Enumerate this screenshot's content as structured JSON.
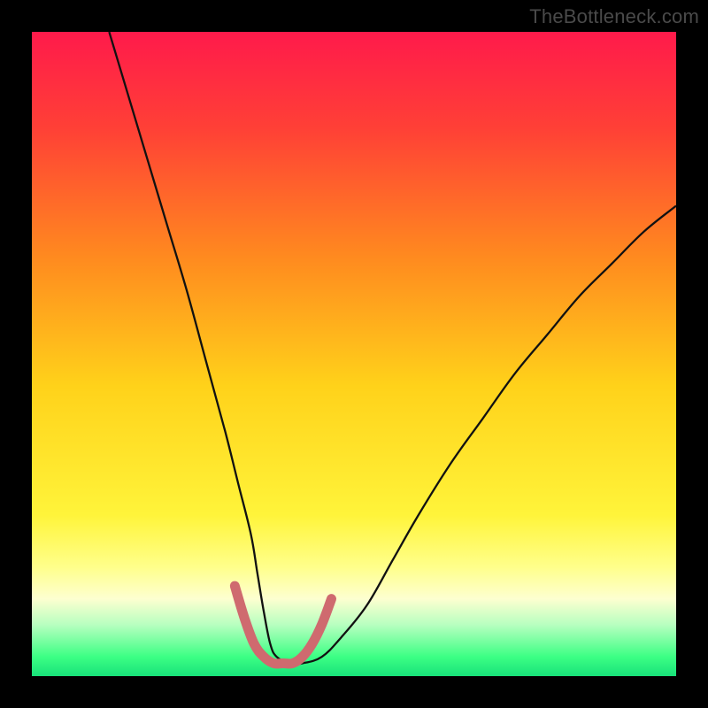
{
  "watermark": "TheBottleneck.com",
  "chart_data": {
    "type": "line",
    "title": "",
    "xlabel": "",
    "ylabel": "",
    "xlim": [
      0,
      100
    ],
    "ylim": [
      0,
      100
    ],
    "grid": false,
    "legend": false,
    "gradient_stops": [
      {
        "offset": 0.0,
        "color": "#ff1a4b"
      },
      {
        "offset": 0.15,
        "color": "#ff4036"
      },
      {
        "offset": 0.35,
        "color": "#ff8a1f"
      },
      {
        "offset": 0.55,
        "color": "#ffd21a"
      },
      {
        "offset": 0.75,
        "color": "#fff43a"
      },
      {
        "offset": 0.83,
        "color": "#ffff8a"
      },
      {
        "offset": 0.88,
        "color": "#fdffd0"
      },
      {
        "offset": 0.92,
        "color": "#b8ffc0"
      },
      {
        "offset": 0.97,
        "color": "#3cff84"
      },
      {
        "offset": 1.0,
        "color": "#18e27a"
      }
    ],
    "series": [
      {
        "name": "bottleneck-curve",
        "stroke": "#111111",
        "stroke_width": 2.3,
        "x": [
          12,
          15,
          18,
          21,
          24,
          27,
          30,
          32,
          34,
          35,
          36,
          37,
          38,
          40,
          42,
          45,
          48,
          52,
          56,
          60,
          65,
          70,
          75,
          80,
          85,
          90,
          95,
          100
        ],
        "y": [
          100,
          90,
          80,
          70,
          60,
          49,
          38,
          30,
          22,
          16,
          10,
          5,
          3,
          2,
          2,
          3,
          6,
          11,
          18,
          25,
          33,
          40,
          47,
          53,
          59,
          64,
          69,
          73
        ]
      },
      {
        "name": "highlight-u",
        "stroke": "#cf6a6f",
        "stroke_width": 11,
        "linecap": "round",
        "x": [
          31.5,
          33,
          34.5,
          36,
          37.5,
          39,
          40.5,
          42,
          43.5,
          45,
          46.5
        ],
        "y": [
          14,
          9,
          5,
          3,
          2,
          2,
          2,
          3,
          5,
          8,
          12
        ]
      }
    ]
  }
}
